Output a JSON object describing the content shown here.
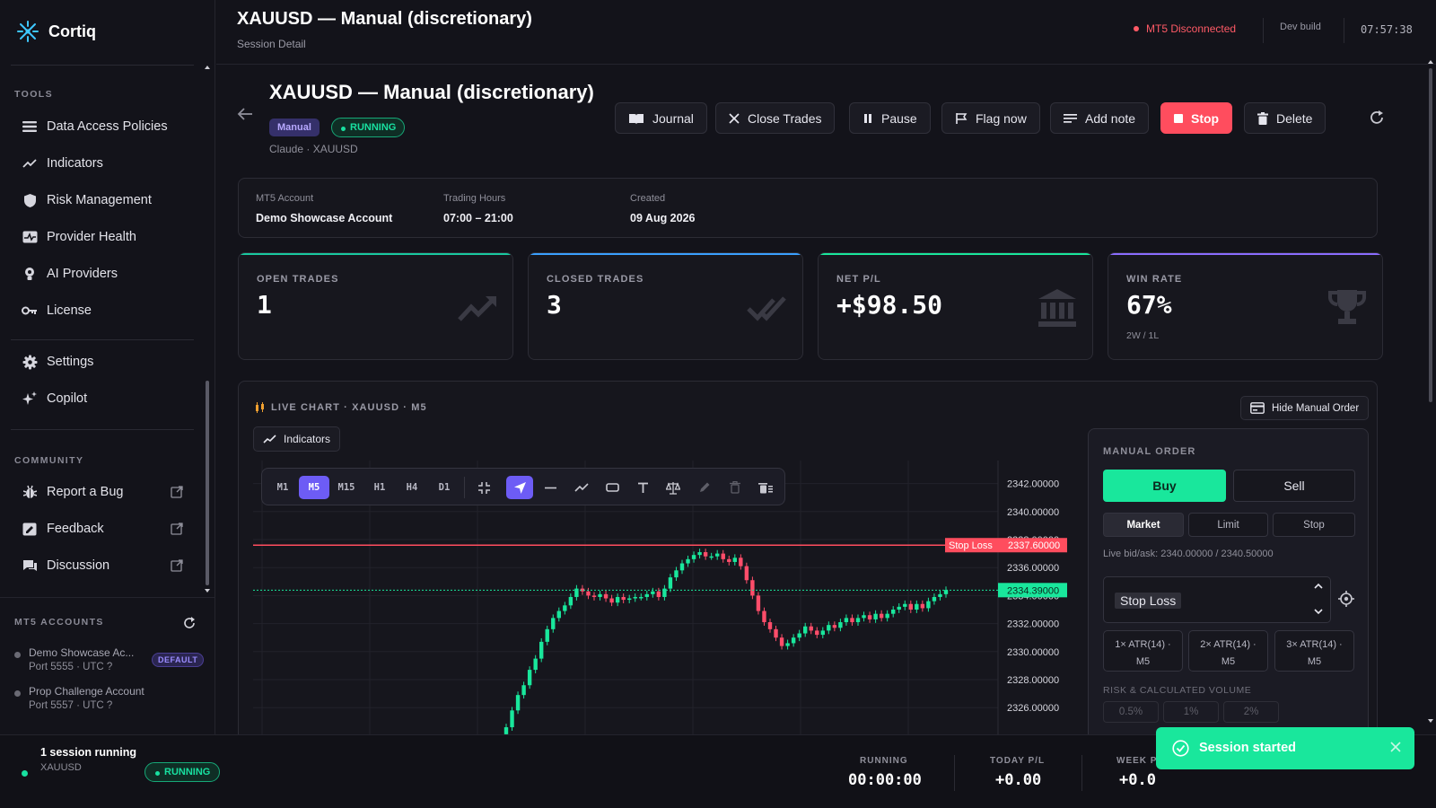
{
  "brand": {
    "name": "Cortiq",
    "accent": "#3ec7ff"
  },
  "sidebar": {
    "tools_label": "TOOLS",
    "tools": [
      {
        "label": "Data Access Policies",
        "icon": "list-icon"
      },
      {
        "label": "Indicators",
        "icon": "trend-icon"
      },
      {
        "label": "Risk Management",
        "icon": "shield-icon"
      },
      {
        "label": "Provider Health",
        "icon": "health-icon"
      },
      {
        "label": "AI Providers",
        "icon": "ai-icon"
      },
      {
        "label": "License",
        "icon": "key-icon"
      }
    ],
    "settings": [
      {
        "label": "Settings",
        "icon": "gear-icon"
      },
      {
        "label": "Copilot",
        "icon": "sparkle-icon"
      }
    ],
    "community_label": "COMMUNITY",
    "community": [
      {
        "label": "Report a Bug",
        "icon": "bug-icon"
      },
      {
        "label": "Feedback",
        "icon": "feedback-icon"
      },
      {
        "label": "Discussion",
        "icon": "chat-icon"
      }
    ],
    "mt5_label": "MT5 ACCOUNTS",
    "accounts": [
      {
        "name": "Demo Showcase Ac...",
        "port": "Port 5555 · UTC ?",
        "badge": "DEFAULT"
      },
      {
        "name": "Prop Challenge Account",
        "port": "Port 5557 · UTC ?"
      }
    ]
  },
  "topbar": {
    "title": "XAUUSD — Manual (discretionary)",
    "subtitle": "Session Detail",
    "status": "MT5 Disconnected",
    "build": "Dev build",
    "clock": "07:57:38"
  },
  "session": {
    "title": "XAUUSD — Manual (discretionary)",
    "tag_mode": "Manual",
    "tag_status": "RUNNING",
    "subtitle": "Claude · XAUUSD",
    "actions": {
      "journal": "Journal",
      "close_trades": "Close Trades",
      "pause": "Pause",
      "flag": "Flag now",
      "note": "Add note",
      "stop": "Stop",
      "delete": "Delete"
    },
    "info": [
      {
        "k": "MT5 Account",
        "v": "Demo Showcase Account"
      },
      {
        "k": "Trading Hours",
        "v": "07:00 – 21:00"
      },
      {
        "k": "Created",
        "v": "09 Aug 2026"
      }
    ],
    "stats": [
      {
        "label": "OPEN TRADES",
        "value": "1",
        "color": "#19c9a0",
        "icon": "trending-up-icon"
      },
      {
        "label": "CLOSED TRADES",
        "value": "3",
        "color": "#3aa0ff",
        "icon": "double-check-icon"
      },
      {
        "label": "NET P/L",
        "value": "+$98.50",
        "color": "#19e79c",
        "icon": "bank-icon"
      },
      {
        "label": "WIN RATE",
        "value": "67%",
        "sub": "2W / 1L",
        "color": "#8b6cff",
        "icon": "trophy-icon"
      }
    ]
  },
  "chart": {
    "title": "LIVE CHART · XAUUSD · M5",
    "indicators_btn": "Indicators",
    "hide_btn": "Hide Manual Order",
    "timeframes": [
      "M1",
      "M5",
      "M15",
      "H1",
      "H4",
      "D1"
    ],
    "active_tf": "M5",
    "stop_loss_label": "Stop Loss",
    "stop_loss_price": "2337.60000",
    "current_price": "2334.39000",
    "y_ticks": [
      "2342.00000",
      "2340.00000",
      "2338.00000",
      "2336.00000",
      "2334.00000",
      "2332.00000",
      "2330.00000",
      "2328.00000",
      "2326.00000"
    ]
  },
  "chart_data": {
    "type": "candlestick",
    "series": [
      {
        "name": "XAUUSD",
        "values": [
          2324.6,
          2325.8,
          2326.9,
          2327.6,
          2328.7,
          2329.5,
          2330.7,
          2331.6,
          2332.4,
          2332.9,
          2333.3,
          2333.9,
          2334.5,
          2334.3,
          2334.0,
          2333.9,
          2334.1,
          2333.8,
          2333.5,
          2333.9,
          2333.7,
          2333.8,
          2333.9,
          2333.9,
          2334.1,
          2334.3,
          2333.9,
          2334.5,
          2335.3,
          2335.8,
          2336.3,
          2336.6,
          2336.9,
          2337.1,
          2336.8,
          2336.8,
          2337.0,
          2336.6,
          2336.4,
          2336.7,
          2336.1,
          2335.1,
          2334.0,
          2332.9,
          2332.1,
          2331.6,
          2331.0,
          2330.4,
          2330.6,
          2331.0,
          2331.3,
          2331.8,
          2331.5,
          2331.2,
          2331.5,
          2331.9,
          2331.7,
          2332.1,
          2332.4,
          2332.1,
          2332.4,
          2332.6,
          2332.3,
          2332.7,
          2332.4,
          2332.7,
          2333.0,
          2333.2,
          2333.4,
          2333.0,
          2333.4,
          2333.1,
          2333.6,
          2333.9,
          2334.1,
          2334.4
        ]
      }
    ],
    "stop_loss": 2337.6,
    "current": 2334.39,
    "ylim": [
      2323,
      2343
    ]
  },
  "manual_order": {
    "title": "MANUAL ORDER",
    "buy": "Buy",
    "sell": "Sell",
    "tabs": [
      "Market",
      "Limit",
      "Stop"
    ],
    "bid_ask": "Live bid/ask: 2340.00000 / 2340.50000",
    "select_value": "Stop Loss",
    "atr": [
      [
        "1× ATR(14) ·",
        "M5"
      ],
      [
        "2× ATR(14) ·",
        "M5"
      ],
      [
        "3× ATR(14) ·",
        "M5"
      ]
    ],
    "risk_label": "RISK & CALCULATED VOLUME",
    "risk": [
      "0.5%",
      "1%",
      "2%"
    ]
  },
  "footer": {
    "sessions": "1 session running",
    "symbol": "XAUUSD",
    "status": "RUNNING",
    "running_k": "RUNNING",
    "running_v": "00:00:00",
    "today_k": "TODAY P/L",
    "today_v": "+0.00",
    "week_k": "WEEK P",
    "week_v": "+0.0"
  },
  "toast": {
    "text": "Session started"
  }
}
